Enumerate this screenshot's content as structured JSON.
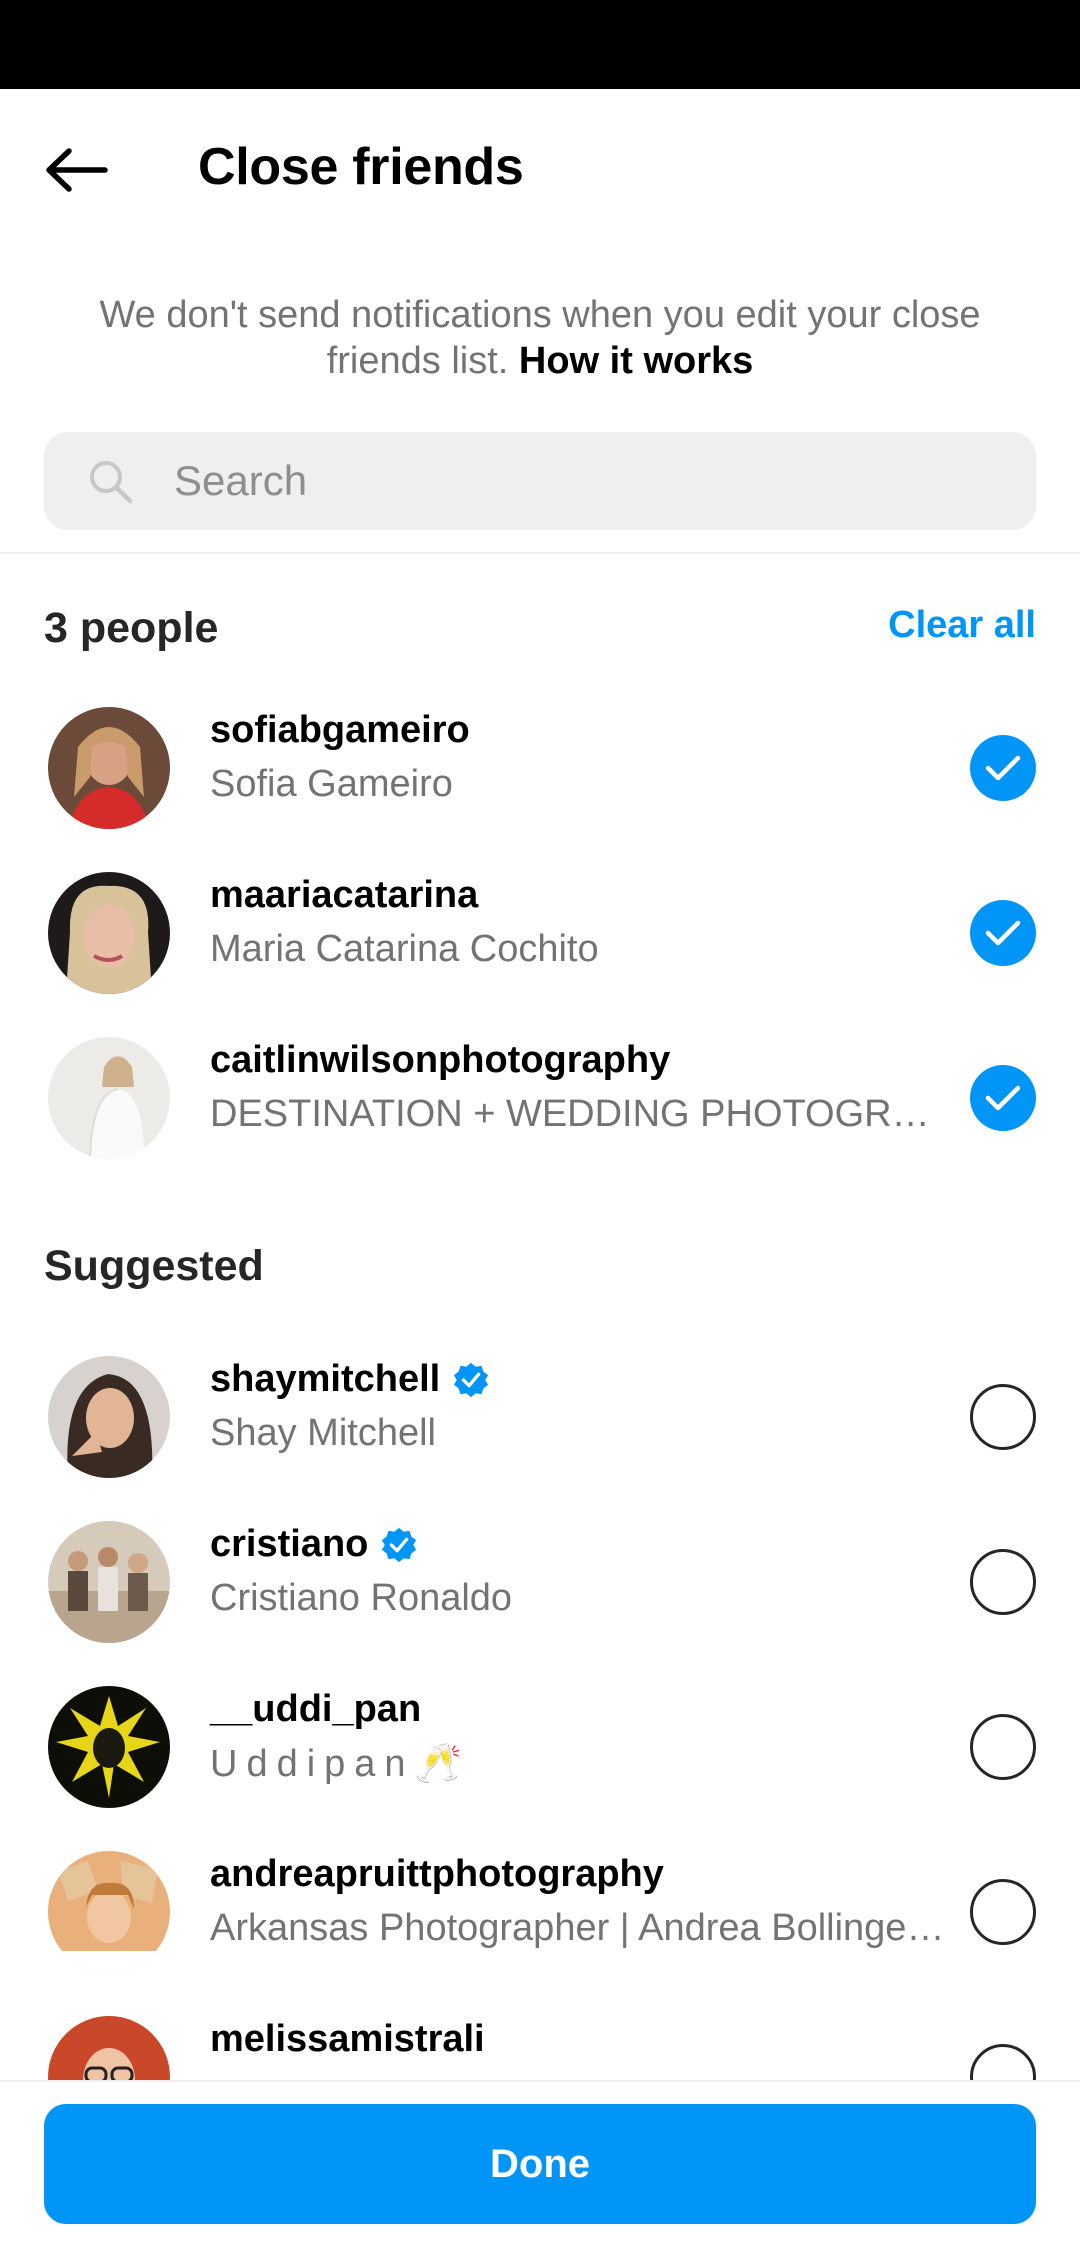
{
  "header": {
    "title": "Close friends"
  },
  "info": {
    "text": "We don't send notifications when you edit your close friends list.",
    "link": "How it works"
  },
  "search": {
    "placeholder": "Search"
  },
  "selected_section": {
    "heading": "3 people",
    "clear_label": "Clear all",
    "people": [
      {
        "username": "sofiabgameiro",
        "full_name": "Sofia Gameiro",
        "verified": false,
        "selected": true
      },
      {
        "username": "maariacatarina",
        "full_name": "Maria Catarina Cochito",
        "verified": false,
        "selected": true
      },
      {
        "username": "caitlinwilsonphotography",
        "full_name": "DESTINATION + WEDDING PHOTOGRAPHER",
        "verified": false,
        "selected": true
      }
    ]
  },
  "suggested_section": {
    "heading": "Suggested",
    "people": [
      {
        "username": "shaymitchell",
        "full_name": "Shay Mitchell",
        "verified": true,
        "selected": false
      },
      {
        "username": "cristiano",
        "full_name": "Cristiano Ronaldo",
        "verified": true,
        "selected": false
      },
      {
        "username": "__uddi_pan",
        "full_name": "Uddipan🥂",
        "verified": false,
        "selected": false
      },
      {
        "username": "andreapruittphotography",
        "full_name": "Arkansas Photographer | Andrea Bollinger Pruitt",
        "verified": false,
        "selected": false
      },
      {
        "username": "melissamistrali",
        "full_name": "",
        "verified": false,
        "selected": false
      }
    ]
  },
  "footer": {
    "done_label": "Done"
  },
  "colors": {
    "accent": "#0095f6",
    "secondary_text": "#737373",
    "search_bg": "#efefef"
  }
}
